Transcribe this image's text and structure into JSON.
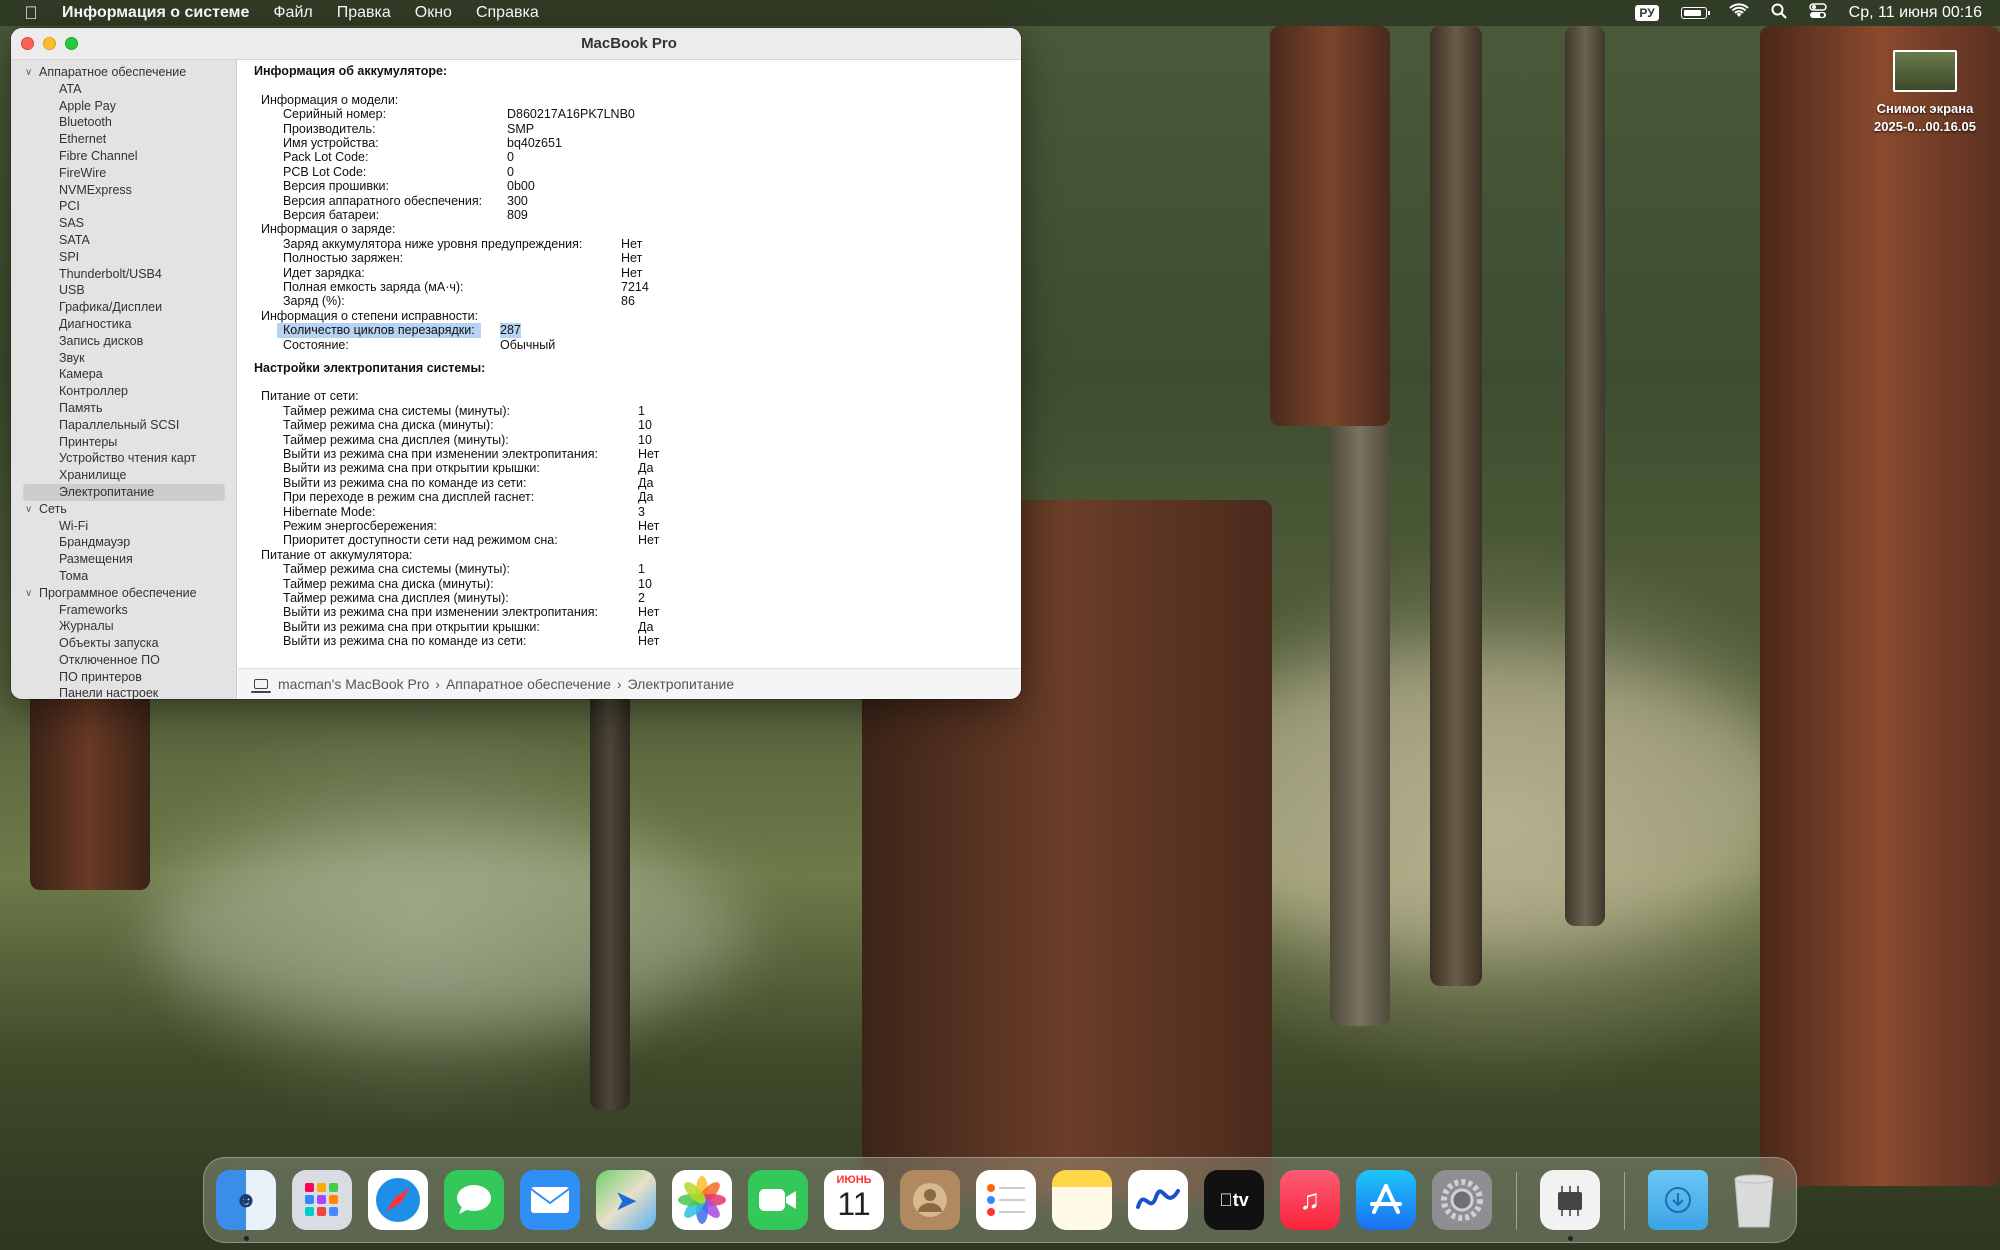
{
  "menubar": {
    "app_name": "Информация о системе",
    "menus": [
      "Файл",
      "Правка",
      "Окно",
      "Справка"
    ],
    "input_source": "РУ",
    "datetime": "Ср, 11 июня  00:16"
  },
  "window": {
    "title": "MacBook Pro"
  },
  "sidebar": {
    "hardware_group": "Аппаратное обеспечение",
    "hardware_items": [
      "ATA",
      "Apple Pay",
      "Bluetooth",
      "Ethernet",
      "Fibre Channel",
      "FireWire",
      "NVMExpress",
      "PCI",
      "SAS",
      "SATA",
      "SPI",
      "Thunderbolt/USB4",
      "USB",
      "Графика/Дисплеи",
      "Диагностика",
      "Запись дисков",
      "Звук",
      "Камера",
      "Контроллер",
      "Память",
      "Параллельный SCSI",
      "Принтеры",
      "Устройство чтения карт",
      "Хранилище",
      "Электропитание"
    ],
    "selected_item": "Электропитание",
    "network_group": "Сеть",
    "network_items": [
      "Wi-Fi",
      "Брандмауэр",
      "Размещения",
      "Тома"
    ],
    "software_group": "Программное обеспечение",
    "software_items": [
      "Frameworks",
      "Журналы",
      "Объекты запуска",
      "Отключенное ПО",
      "ПО принтеров",
      "Панели настроек"
    ]
  },
  "content": {
    "battery_header": "Информация об аккумуляторе:",
    "model_info_label": "Информация о модели:",
    "model_info": [
      {
        "k": "Серийный номер:",
        "v": "D860217A16PK7LNB0"
      },
      {
        "k": "Производитель:",
        "v": "SMP"
      },
      {
        "k": "Имя устройства:",
        "v": "bq40z651"
      },
      {
        "k": "Pack Lot Code:",
        "v": "0"
      },
      {
        "k": "PCB Lot Code:",
        "v": "0"
      },
      {
        "k": "Версия прошивки:",
        "v": "0b00"
      },
      {
        "k": "Версия аппаратного обеспечения:",
        "v": "300"
      },
      {
        "k": "Версия батареи:",
        "v": "809"
      }
    ],
    "charge_info_label": "Информация о заряде:",
    "charge_info": [
      {
        "k": "Заряд аккумулятора ниже уровня предупреждения:",
        "v": "Нет"
      },
      {
        "k": "Полностью заряжен:",
        "v": "Нет"
      },
      {
        "k": "Идет зарядка:",
        "v": "Нет"
      },
      {
        "k": "Полная емкость заряда (мА·ч):",
        "v": "7214"
      },
      {
        "k": "Заряд (%):",
        "v": "86"
      }
    ],
    "health_info_label": "Информация о степени исправности:",
    "health_info": [
      {
        "k": "Количество циклов перезарядки:",
        "v": "287"
      },
      {
        "k": "Состояние:",
        "v": "Обычный"
      }
    ],
    "power_header": "Настройки электропитания системы:",
    "ac_label": "Питание от сети:",
    "ac_settings": [
      {
        "k": "Таймер режима сна системы (минуты):",
        "v": "1"
      },
      {
        "k": "Таймер режима сна диска (минуты):",
        "v": "10"
      },
      {
        "k": "Таймер режима сна дисплея (минуты):",
        "v": "10"
      },
      {
        "k": "Выйти из режима сна при изменении электропитания:",
        "v": "Нет"
      },
      {
        "k": "Выйти из режима сна при открытии крышки:",
        "v": "Да"
      },
      {
        "k": "Выйти из режима сна по команде из сети:",
        "v": "Да"
      },
      {
        "k": "При переходе в режим сна дисплей гаснет:",
        "v": "Да"
      },
      {
        "k": "Hibernate Mode:",
        "v": "3"
      },
      {
        "k": "Режим энергосбережения:",
        "v": "Нет"
      },
      {
        "k": "Приоритет доступности сети над режимом сна:",
        "v": "Нет"
      }
    ],
    "battery_power_label": "Питание от аккумулятора:",
    "battery_settings": [
      {
        "k": "Таймер режима сна системы (минуты):",
        "v": "1"
      },
      {
        "k": "Таймер режима сна диска (минуты):",
        "v": "10"
      },
      {
        "k": "Таймер режима сна дисплея (минуты):",
        "v": "2"
      },
      {
        "k": "Выйти из режима сна при изменении электропитания:",
        "v": "Нет"
      },
      {
        "k": "Выйти из режима сна при открытии крышки:",
        "v": "Да"
      },
      {
        "k": "Выйти из режима сна по команде из сети:",
        "v": "Нет"
      }
    ]
  },
  "pathbar": {
    "computer": "macman's MacBook Pro",
    "sep": "›",
    "section": "Аппаратное обеспечение",
    "item": "Электропитание"
  },
  "desktop_file": {
    "line1": "Снимок экрана",
    "line2": "2025-0...00.16.05"
  },
  "dock": {
    "calendar_month": "ИЮНЬ",
    "calendar_day": "11",
    "apps": [
      "finder-icon",
      "launchpad-icon",
      "safari-icon",
      "messages-icon",
      "mail-icon",
      "maps-icon",
      "photos-icon",
      "facetime-icon",
      "calendar-icon",
      "contacts-icon",
      "reminders-icon",
      "notes-icon",
      "freeform-icon",
      "tv-icon",
      "music-icon",
      "app-store-icon",
      "system-settings-icon",
      "system-information-icon",
      "downloads-folder-icon",
      "trash-icon"
    ]
  }
}
